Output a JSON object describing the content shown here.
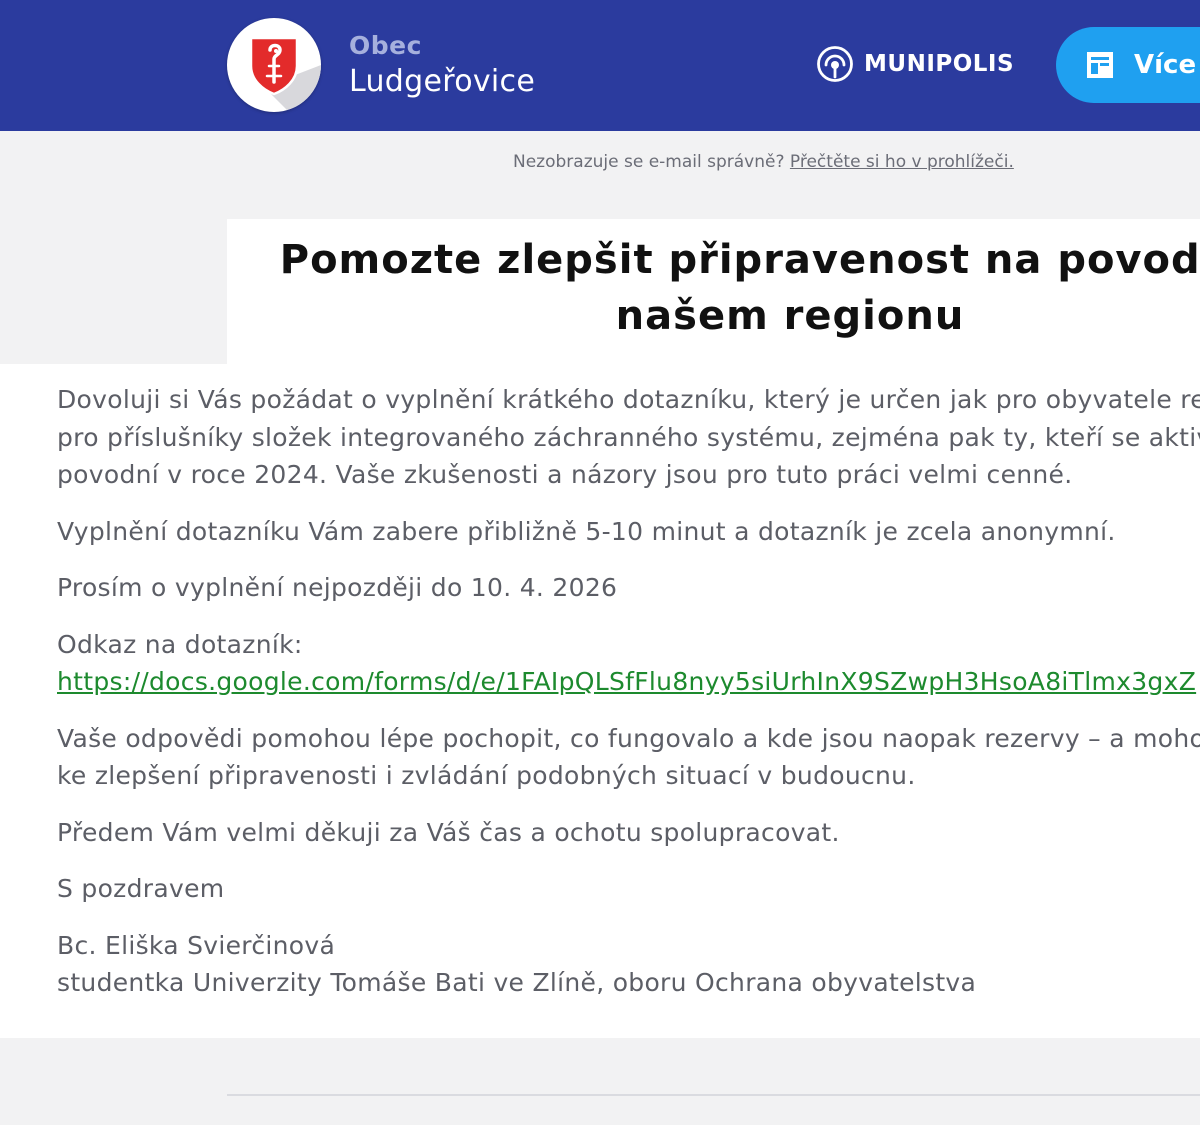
{
  "header": {
    "org_small": "Obec",
    "org_name": "Ludgeřovice",
    "platform_name": "MUNIPOLIS",
    "more_button": "Více",
    "colors": {
      "header_bg": "#2b3b9e",
      "button_bg": "#1fa0f0",
      "crest_red": "#e32b2b"
    },
    "icons": {
      "crest": "municipal-crest-icon",
      "platform": "munipolis-logo-icon",
      "more": "document-icon"
    }
  },
  "preview": {
    "text": "Nezobrazuje se e-mail správně? ",
    "link": "Přečtěte si ho v prohlížeči."
  },
  "article": {
    "title_line1": "Pomozte zlepšit připravenost na povodně v",
    "title_line2": "našem regionu",
    "p1": [
      "Dovoluji si Vás požádat o vyplnění krátkého dotazníku, který je určen jak pro obyvatele regionu, tak",
      "pro příslušníky složek integrovaného záchranného systému, zejména pak ty, kteří se aktivně podíleli na",
      "povodní v roce 2024. Vaše zkušenosti a názory jsou pro tuto práci velmi cenné."
    ],
    "p2": "Vyplnění dotazníku Vám zabere přibližně 5-10 minut a dotazník je zcela anonymní.",
    "p3": "Prosím o vyplnění  nejpozději do 10. 4. 2026",
    "p4_label": "Odkaz na dotazník:",
    "p4_link": "https://docs.google.com/forms/d/e/1FAIpQLSfFlu8nyy5siUrhInX9SZwpH3HsoA8iTlmx3gxZ",
    "p5": [
      "Vaše odpovědi pomohou lépe pochopit, co fungovalo a kde jsou naopak rezervy – a mohou tak přispět",
      "ke zlepšení připravenosti i zvládání podobných situací v budoucnu."
    ],
    "p6": "Předem Vám velmi děkuji za Váš čas a ochotu spolupracovat.",
    "p7": "S pozdravem",
    "signature": [
      "Bc. Eliška Svierčinová",
      "studentka Univerzity Tomáše Bati ve Zlíně, oboru Ochrana obyvatelstva"
    ],
    "link_color": "#1d8a2e"
  }
}
